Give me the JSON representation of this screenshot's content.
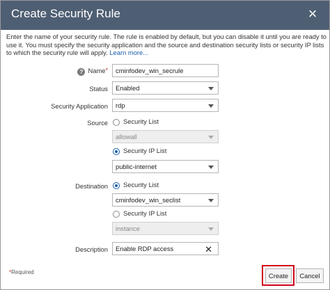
{
  "dialog": {
    "title": "Create Security Rule",
    "close_symbol": "×",
    "intro_text": "Enter the name of your security rule. The rule is enabled by default, but you can disable it until you are ready to use it. You must specify the security application and the source and destination security lists or security IP lists to which the security rule will apply. ",
    "learn_more": "Learn more..."
  },
  "form": {
    "help_symbol": "?",
    "required_mark": "*",
    "name": {
      "label": "Name",
      "value": "cminfodev_win_secrule"
    },
    "status": {
      "label": "Status",
      "value": "Enabled"
    },
    "security_application": {
      "label": "Security Application",
      "value": "rdp"
    },
    "source": {
      "label": "Source",
      "security_list_label": "Security List",
      "security_list_value": "allowall",
      "security_ip_list_label": "Security IP List",
      "security_ip_list_value": "public-internet",
      "selected": "security_ip_list"
    },
    "destination": {
      "label": "Destination",
      "security_list_label": "Security List",
      "security_list_value": "cminfodev_win_seclist",
      "security_ip_list_label": "Security IP List",
      "security_ip_list_value": "instance",
      "selected": "security_list"
    },
    "description": {
      "label": "Description",
      "value": "Enable RDP access",
      "clear_symbol": "✕"
    }
  },
  "footer": {
    "required_note": "Required",
    "create_label": "Create",
    "cancel_label": "Cancel"
  },
  "colors": {
    "titlebar": "#4f5f73",
    "link": "#1a5ea8",
    "highlight": "#d0021b"
  }
}
